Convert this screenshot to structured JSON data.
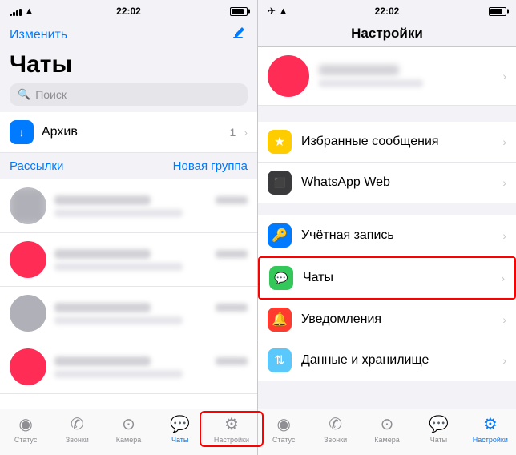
{
  "left": {
    "status_bar": {
      "time": "22:02"
    },
    "nav": {
      "edit_label": "Изменить",
      "compose_icon": "✏️"
    },
    "title": "Чаты",
    "search_placeholder": "Поиск",
    "archive": {
      "label": "Архив",
      "count": "1",
      "icon": "📁"
    },
    "broadcast_label": "Рассылки",
    "new_group_label": "Новая группа",
    "tabs": [
      {
        "label": "Статус",
        "icon": "⏺",
        "active": false
      },
      {
        "label": "Звонки",
        "icon": "📞",
        "active": false
      },
      {
        "label": "Камера",
        "icon": "📷",
        "active": false
      },
      {
        "label": "Чаты",
        "icon": "💬",
        "active": true
      },
      {
        "label": "Настройки",
        "icon": "⚙️",
        "active": false
      }
    ]
  },
  "right": {
    "status_bar": {
      "time": "22:02"
    },
    "title": "Настройки",
    "settings_items": [
      {
        "label": "Избранные сообщения",
        "icon_color": "icon-yellow",
        "icon": "★"
      },
      {
        "label": "WhatsApp Web",
        "icon_color": "icon-dark",
        "icon": "🖥"
      },
      {
        "label": "Учётная запись",
        "icon_color": "icon-blue",
        "icon": "🔑"
      },
      {
        "label": "Чаты",
        "icon_color": "icon-green",
        "icon": "💬",
        "highlighted": true
      },
      {
        "label": "Уведомления",
        "icon_color": "icon-red",
        "icon": "🔔"
      },
      {
        "label": "Данные и хранилище",
        "icon_color": "icon-teal",
        "icon": "↕"
      }
    ],
    "tabs": [
      {
        "label": "Статус",
        "icon": "⏺",
        "active": false
      },
      {
        "label": "Звонки",
        "icon": "📞",
        "active": false
      },
      {
        "label": "Камера",
        "icon": "📷",
        "active": false
      },
      {
        "label": "Чаты",
        "icon": "💬",
        "active": false
      },
      {
        "label": "Настройки",
        "icon": "⚙️",
        "active": true
      }
    ]
  }
}
